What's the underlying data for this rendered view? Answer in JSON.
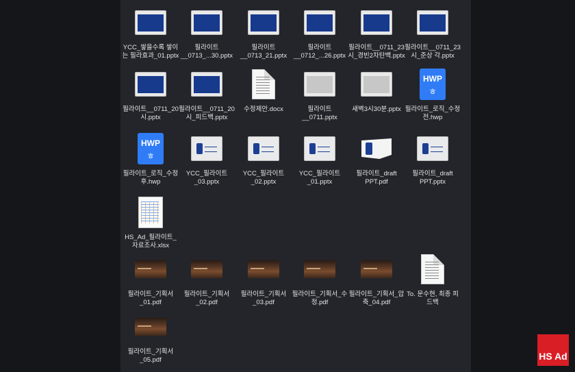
{
  "brand_logo": "HS Ad",
  "files": [
    {
      "id": "f1",
      "label": "YCC_쌓을수록 쌓이\n는 필라효과_01.pptx",
      "kind": "slide"
    },
    {
      "id": "f2",
      "label": "필라이트\n__0713_...30.pptx",
      "kind": "slide"
    },
    {
      "id": "f3",
      "label": "필라이트\n__0713_21.pptx",
      "kind": "slide"
    },
    {
      "id": "f4",
      "label": "필라이트\n__0712_...26.pptx",
      "kind": "slide"
    },
    {
      "id": "f5",
      "label": "필라이트__0711_23\n시_경빈2차탄백.pptx",
      "kind": "slide"
    },
    {
      "id": "f6",
      "label": "필라이트__0711_23\n시_준상 각.pptx",
      "kind": "slide"
    },
    {
      "id": "f7",
      "label": "필라이트__0711_20\n시.pptx",
      "kind": "slide"
    },
    {
      "id": "f8",
      "label": "필라이트__0711_20\n시_피드백.pptx",
      "kind": "slide"
    },
    {
      "id": "f9",
      "label": "수정제안.docx",
      "kind": "doc"
    },
    {
      "id": "f10",
      "label": "필라이트\n__0711.pptx",
      "kind": "slide-blank"
    },
    {
      "id": "f11",
      "label": "새벽3시30분.pptx",
      "kind": "slide-blank"
    },
    {
      "id": "f12",
      "label": "필라이트_로직_수정\n전.hwp",
      "kind": "hwp"
    },
    {
      "id": "f13",
      "label": "필라이트_로직_수정\n후.hwp",
      "kind": "hwp"
    },
    {
      "id": "f14",
      "label": "YCC_필라이트\n_03.pptx",
      "kind": "slide-logo"
    },
    {
      "id": "f15",
      "label": "YCC_필라이트\n_02.pptx",
      "kind": "slide-logo"
    },
    {
      "id": "f16",
      "label": "YCC_필라이트\n_01.pptx",
      "kind": "slide-logo"
    },
    {
      "id": "f17",
      "label": "필라이트_draft\nPPT.pdf",
      "kind": "pdf-draft"
    },
    {
      "id": "f18",
      "label": "필라이트_draft\nPPT.pptx",
      "kind": "slide-logo"
    },
    {
      "id": "f19",
      "label": "HS_Ad_필라이트_\n자료조사.xlsx",
      "kind": "sheet"
    },
    {
      "id": "f20",
      "label": "필라이트_기획서\n_01.pdf",
      "kind": "pdf"
    },
    {
      "id": "f21",
      "label": "필라이트_기획서\n_02.pdf",
      "kind": "pdf"
    },
    {
      "id": "f22",
      "label": "필라이트_기획서\n_03.pdf",
      "kind": "pdf"
    },
    {
      "id": "f23",
      "label": "필라이트_기획서_수\n정.pdf",
      "kind": "pdf"
    },
    {
      "id": "f24",
      "label": "필라이트_기획서_압\n축_04.pdf",
      "kind": "pdf"
    },
    {
      "id": "f25",
      "label": "To. 문수현, 최종 피\n드백",
      "kind": "doc"
    },
    {
      "id": "f26",
      "label": "필라이트_기획서\n_05.pdf",
      "kind": "pdf"
    }
  ],
  "icons": {
    "hwp_text": "HWP",
    "hwp_glyph": "ㅎ"
  }
}
